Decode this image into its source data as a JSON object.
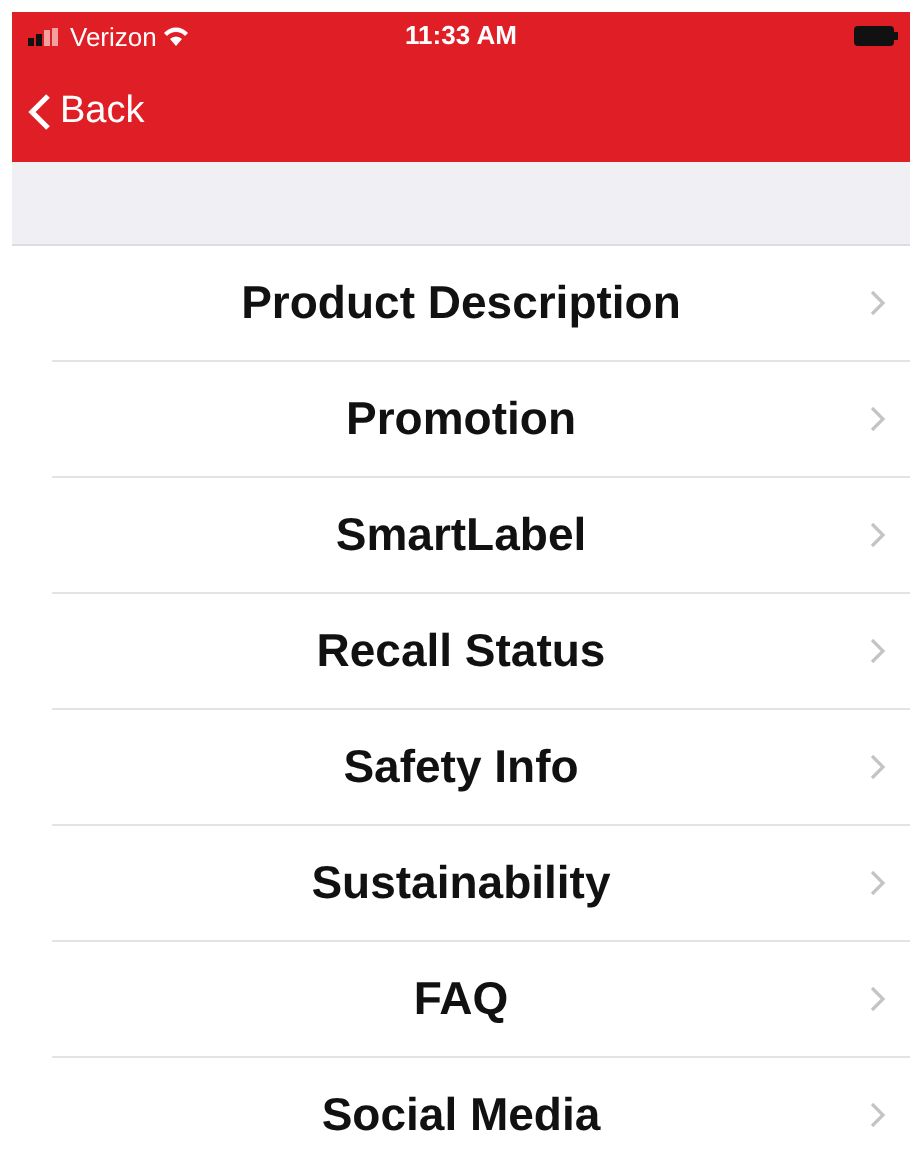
{
  "status_bar": {
    "carrier": "Verizon",
    "time": "11:33 AM"
  },
  "nav": {
    "back": "Back"
  },
  "menu": [
    {
      "label": "Product Description"
    },
    {
      "label": "Promotion"
    },
    {
      "label": "SmartLabel"
    },
    {
      "label": "Recall Status"
    },
    {
      "label": "Safety Info"
    },
    {
      "label": "Sustainability"
    },
    {
      "label": "FAQ"
    },
    {
      "label": "Social Media"
    }
  ]
}
